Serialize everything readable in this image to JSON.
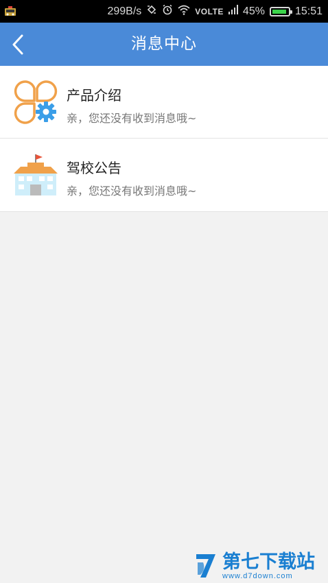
{
  "status_bar": {
    "speed": "299B/s",
    "network": "VOLTE",
    "battery": "45%",
    "battery_level": 0.9,
    "time": "15:51"
  },
  "header": {
    "title": "消息中心",
    "back_icon": "chevron-left-icon"
  },
  "messages": [
    {
      "title": "产品介绍",
      "preview": "亲，您还没有收到消息哦~",
      "icon": "product-intro-icon"
    },
    {
      "title": "驾校公告",
      "preview": "亲，您还没有收到消息哦~",
      "icon": "school-notice-icon"
    }
  ],
  "watermark": {
    "brand": "第七下载站",
    "domain": "www.d7down.com"
  },
  "colors": {
    "header": "#4a8ad8",
    "background": "#f2f2f2",
    "accent_orange": "#f0a14a",
    "accent_blue": "#3a9ee8"
  }
}
